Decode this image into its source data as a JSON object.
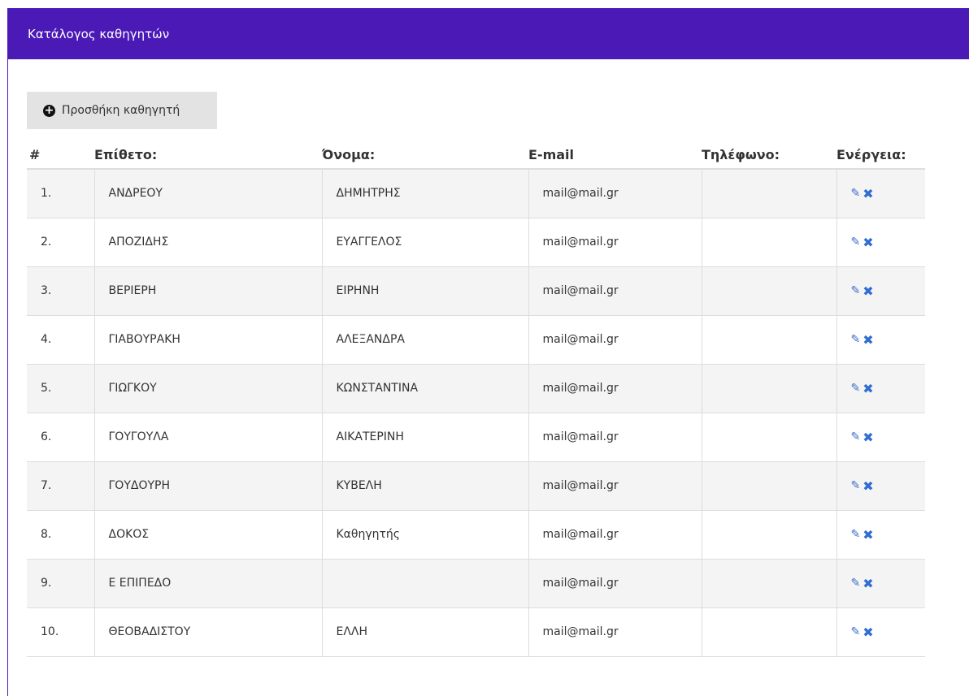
{
  "panel": {
    "title": "Κατάλογος καθηγητών"
  },
  "toolbar": {
    "add_label": "Προσθήκη καθηγητή",
    "add_icon": "plus-circle-icon"
  },
  "table": {
    "headers": [
      "#",
      "Επίθετο:",
      "Όνομα:",
      "E-mail",
      "Τηλέφωνο:",
      "Ενέργεια:"
    ],
    "rows": [
      {
        "num": "1.",
        "surname": "ΑΝΔΡΕΟΥ",
        "name": "ΔΗΜΗΤΡΗΣ",
        "email": "mail@mail.gr",
        "phone": ""
      },
      {
        "num": "2.",
        "surname": "ΑΠΟΖΙΔΗΣ",
        "name": "ΕΥΑΓΓΕΛΟΣ",
        "email": "mail@mail.gr",
        "phone": ""
      },
      {
        "num": "3.",
        "surname": "ΒΕΡΙΕΡΗ",
        "name": "ΕΙΡΗΝΗ",
        "email": "mail@mail.gr",
        "phone": ""
      },
      {
        "num": "4.",
        "surname": "ΓΙΑΒΟΥΡΑΚΗ",
        "name": "ΑΛΕΞΑΝΔΡΑ",
        "email": "mail@mail.gr",
        "phone": ""
      },
      {
        "num": "5.",
        "surname": "ΓΙΩΓΚΟΥ",
        "name": "ΚΩΝΣΤΑΝΤΙΝΑ",
        "email": "mail@mail.gr",
        "phone": ""
      },
      {
        "num": "6.",
        "surname": "ΓΟΥΓΟΥΛΑ",
        "name": "ΑΙΚΑΤΕΡΙΝΗ",
        "email": "mail@mail.gr",
        "phone": ""
      },
      {
        "num": "7.",
        "surname": "ΓΟΥΔΟΥΡΗ",
        "name": "ΚΥΒΕΛΗ",
        "email": "mail@mail.gr",
        "phone": ""
      },
      {
        "num": "8.",
        "surname": "ΔΟΚΟΣ",
        "name": "Καθηγητής",
        "email": "mail@mail.gr",
        "phone": ""
      },
      {
        "num": "9.",
        "surname": "Ε ΕΠΙΠΕΔΟ",
        "name": "",
        "email": "mail@mail.gr",
        "phone": ""
      },
      {
        "num": "10.",
        "surname": "ΘΕΟΒΑΔΙΣΤΟΥ",
        "name": "ΕΛΛΗ",
        "email": "mail@mail.gr",
        "phone": ""
      }
    ]
  },
  "colors": {
    "header_bg": "#4a19b6",
    "action_icon": "#2f6dd1"
  }
}
